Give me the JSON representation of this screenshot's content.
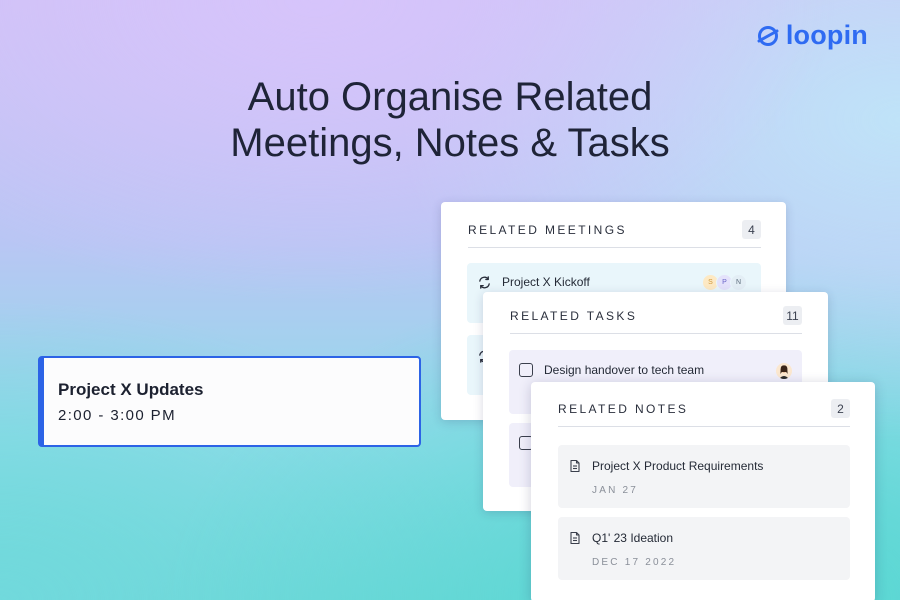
{
  "brand": {
    "name": "loopin",
    "color": "#2f6bf2"
  },
  "headline": {
    "line1": "Auto Organise Related",
    "line2": "Meetings, Notes & Tasks"
  },
  "event": {
    "title": "Project X Updates",
    "time": "2:00 - 3:00 PM",
    "accent": "#2c63e6"
  },
  "meetings": {
    "title": "RELATED MEETINGS",
    "count": "4",
    "items": [
      {
        "label": "Project X Kickoff",
        "icon": "recurring-icon",
        "avatars": [
          "S",
          "P",
          "N"
        ]
      },
      {
        "label": "",
        "icon": "recurring-icon",
        "avatars": []
      }
    ]
  },
  "tasks": {
    "title": "RELATED TASKS",
    "count": "11",
    "items": [
      {
        "label": "Design handover to tech team",
        "icon": "checkbox-icon"
      },
      {
        "label": "",
        "icon": "checkbox-icon"
      }
    ]
  },
  "notes": {
    "title": "RELATED NOTES",
    "count": "2",
    "items": [
      {
        "label": "Project X Product Requirements",
        "date": "JAN 27",
        "icon": "document-icon"
      },
      {
        "label": "Q1' 23 Ideation",
        "date": "DEC 17 2022",
        "icon": "document-icon"
      }
    ]
  }
}
